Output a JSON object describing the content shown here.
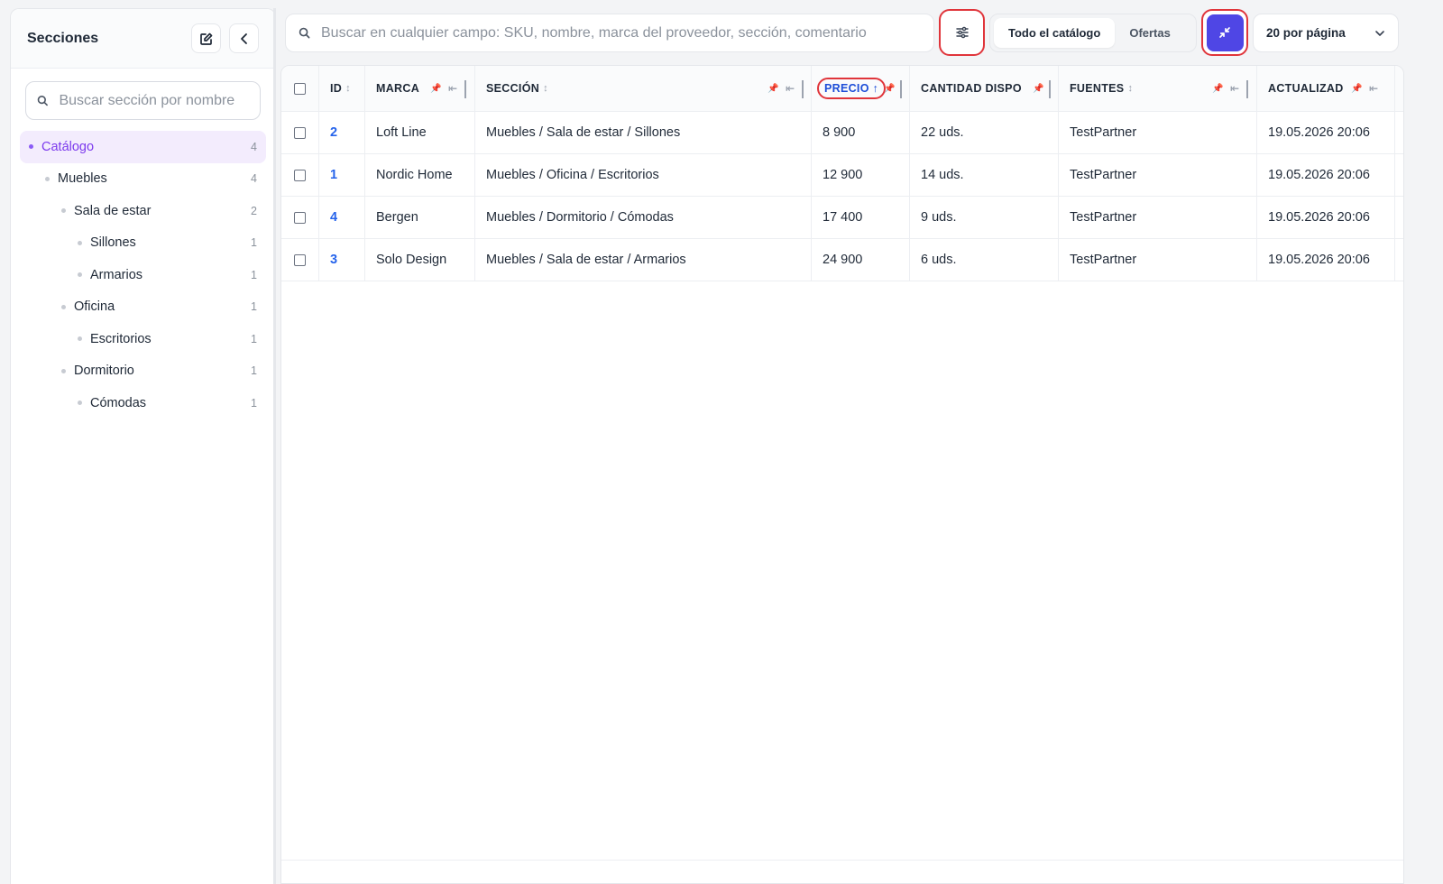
{
  "sidebar": {
    "title": "Secciones",
    "search_placeholder": "Buscar sección por nombre",
    "tree": [
      {
        "label": "Catálogo",
        "count": "4",
        "level": 0,
        "active": true
      },
      {
        "label": "Muebles",
        "count": "4",
        "level": 1
      },
      {
        "label": "Sala de estar",
        "count": "2",
        "level": 2
      },
      {
        "label": "Sillones",
        "count": "1",
        "level": 3
      },
      {
        "label": "Armarios",
        "count": "1",
        "level": 3
      },
      {
        "label": "Oficina",
        "count": "1",
        "level": 2
      },
      {
        "label": "Escritorios",
        "count": "1",
        "level": 3
      },
      {
        "label": "Dormitorio",
        "count": "1",
        "level": 2
      },
      {
        "label": "Cómodas",
        "count": "1",
        "level": 3
      }
    ]
  },
  "toolbar": {
    "search_placeholder": "Buscar en cualquier campo: SKU, nombre, marca del proveedor, sección, comentario",
    "segment": [
      "Todo el catálogo",
      "Ofertas"
    ],
    "segment_active": "Todo el catálogo",
    "per_page": "20 por página"
  },
  "table": {
    "columns": [
      "ID",
      "MARCA",
      "SECCIÓN",
      "PRECIO",
      "CANTIDAD DISPO",
      "FUENTES",
      "ACTUALIZAD"
    ],
    "rows": [
      {
        "id": "2",
        "marca": "Loft Line",
        "seccion": "Muebles / Sala de estar / Sillones",
        "precio": "8 900",
        "cantidad": "22 uds.",
        "fuentes": "TestPartner",
        "actualizado": "19.05.2026 20:06"
      },
      {
        "id": "1",
        "marca": "Nordic Home",
        "seccion": "Muebles / Oficina / Escritorios",
        "precio": "12 900",
        "cantidad": "14 uds.",
        "fuentes": "TestPartner",
        "actualizado": "19.05.2026 20:06"
      },
      {
        "id": "4",
        "marca": "Bergen",
        "seccion": "Muebles / Dormitorio / Cómodas",
        "precio": "17 400",
        "cantidad": "9 uds.",
        "fuentes": "TestPartner",
        "actualizado": "19.05.2026 20:06"
      },
      {
        "id": "3",
        "marca": "Solo Design",
        "seccion": "Muebles / Sala de estar / Armarios",
        "precio": "24 900",
        "cantidad": "6 uds.",
        "fuentes": "TestPartner",
        "actualizado": "19.05.2026 20:06"
      }
    ]
  },
  "colors": {
    "accent": "#4f46e5",
    "active_tree": "#7c3aed",
    "highlight_border": "#e0353b",
    "id_link": "#2563eb"
  }
}
